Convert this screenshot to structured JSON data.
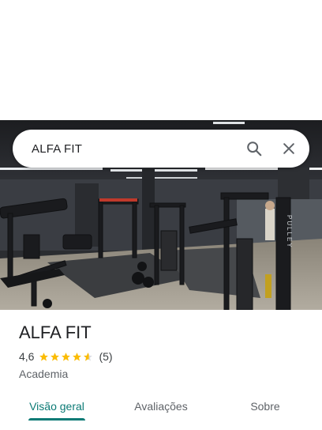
{
  "search": {
    "query": "ALFA FIT"
  },
  "place": {
    "name": "ALFA FIT",
    "rating": "4,6",
    "stars": 4.6,
    "review_count": "(5)",
    "category": "Academia"
  },
  "tabs": [
    {
      "label": "Visão geral",
      "active": true
    },
    {
      "label": "Avaliações",
      "active": false
    },
    {
      "label": "Sobre",
      "active": false
    }
  ],
  "colors": {
    "accent": "#0b7a75",
    "star": "#fbbc04"
  },
  "icons": [
    "search-icon",
    "close-icon",
    "star-icon"
  ],
  "photo": {
    "wall_text": "PULLEY"
  }
}
